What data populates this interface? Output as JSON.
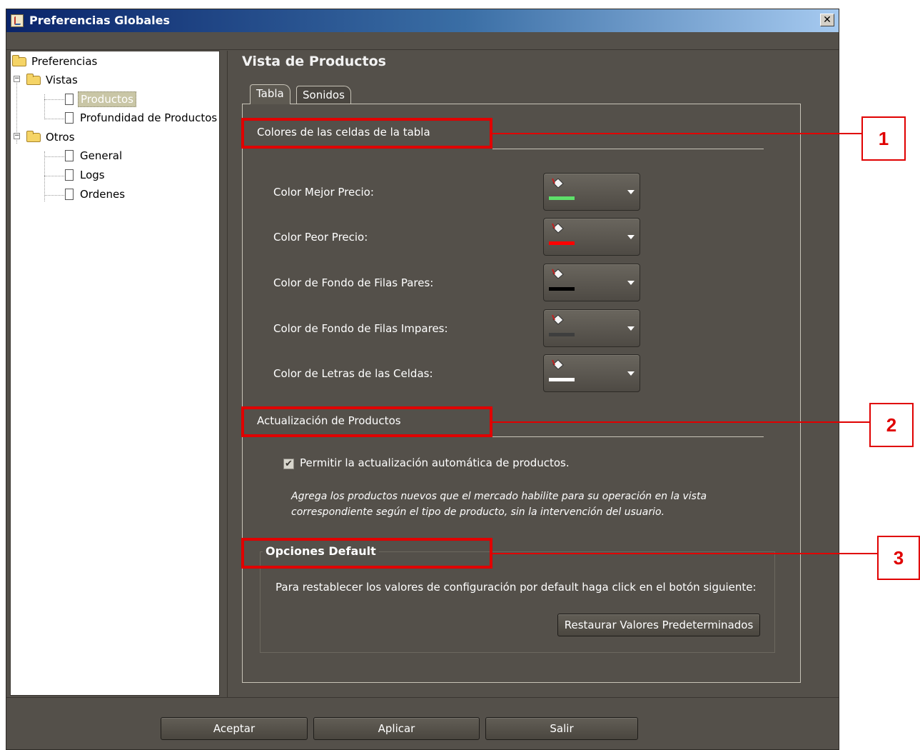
{
  "window": {
    "title": "Preferencias Globales",
    "close_glyph": "✕"
  },
  "tree": {
    "root": "Preferencias",
    "vistas": "Vistas",
    "productos": "Productos",
    "profundidad": "Profundidad de Productos",
    "otros": "Otros",
    "general": "General",
    "logs": "Logs",
    "ordenes": "Ordenes",
    "expander_glyph": "−"
  },
  "main": {
    "title": "Vista de Productos",
    "tabs": [
      {
        "label": "Tabla",
        "selected": true
      },
      {
        "label": "Sonidos",
        "selected": false
      }
    ],
    "colors_section": {
      "title": "Colores de las celdas de la tabla",
      "rows": [
        {
          "label": "Color Mejor Precio:",
          "color": "#5ee06a"
        },
        {
          "label": "Color Peor Precio:",
          "color": "#ff0000"
        },
        {
          "label": "Color de Fondo de Filas Pares:",
          "color": "#000000"
        },
        {
          "label": "Color de Fondo de Filas Impares:",
          "color": "#3e3e3e"
        },
        {
          "label": "Color de Letras de las Celdas:",
          "color": "#ffffff"
        }
      ]
    },
    "update_section": {
      "title": "Actualización de Productos",
      "checkbox_label": "Permitir la actualización automática de productos.",
      "checked": true,
      "description": "Agrega los productos nuevos que el mercado habilite para su operación en la vista correspondiente según el tipo de producto, sin la intervención del usuario."
    },
    "defaults_section": {
      "title": "Opciones Default",
      "text": "Para restablecer los valores de configuración por default haga click en el botón siguiente:",
      "restore_button": "Restaurar Valores Predeterminados"
    }
  },
  "footer": {
    "accept": "Aceptar",
    "apply": "Aplicar",
    "exit": "Salir"
  },
  "annotations": [
    "1",
    "2",
    "3"
  ],
  "accent_color": "#e00000"
}
